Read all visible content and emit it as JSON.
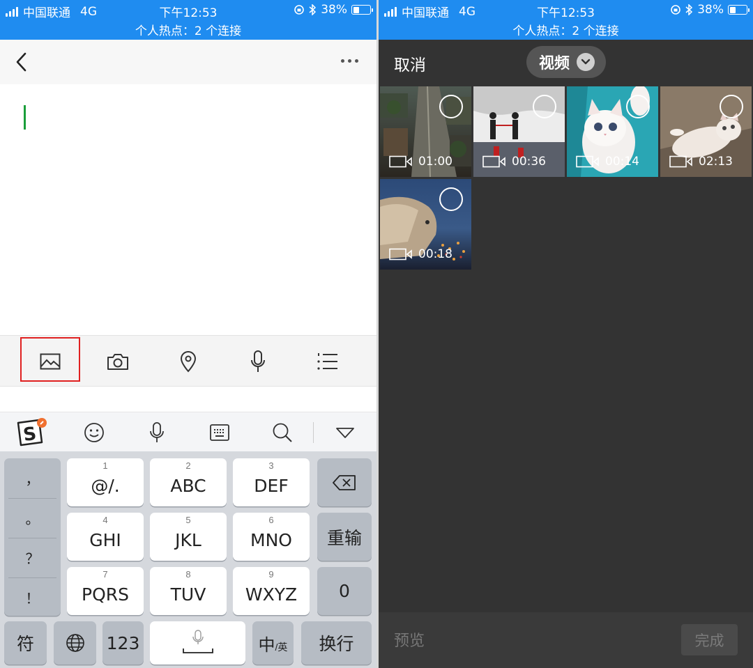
{
  "status_bar": {
    "carrier": "中国联通",
    "network": "4G",
    "time": "下午12:53",
    "battery_percent": "38%",
    "battery_level": 0.38,
    "hotspot": "个人热点：2 个连接"
  },
  "editor": {
    "text": ""
  },
  "attach_bar": {
    "items": [
      "image-icon",
      "camera-icon",
      "location-pin-icon",
      "microphone-icon",
      "list-icon"
    ],
    "highlighted": "image-icon"
  },
  "ime_toolbar": {
    "icons": [
      "sogou-logo-icon",
      "emoji-icon",
      "voice-input-icon",
      "keyboard-icon",
      "search-icon",
      "collapse-keyboard-icon"
    ]
  },
  "keyboard": {
    "punctuation": [
      "，",
      "。",
      "？",
      "！"
    ],
    "keys": [
      {
        "num": "1",
        "label": "@/."
      },
      {
        "num": "2",
        "label": "ABC"
      },
      {
        "num": "3",
        "label": "DEF"
      },
      {
        "num": "4",
        "label": "GHI"
      },
      {
        "num": "5",
        "label": "JKL"
      },
      {
        "num": "6",
        "label": "MNO"
      },
      {
        "num": "7",
        "label": "PQRS"
      },
      {
        "num": "8",
        "label": "TUV"
      },
      {
        "num": "9",
        "label": "WXYZ"
      }
    ],
    "retype": "重输",
    "zero": "0",
    "symbols": "符",
    "numbers": "123",
    "lang_main": "中",
    "lang_sub": "/英",
    "newline": "换行"
  },
  "picker": {
    "cancel": "取消",
    "media_type": "视频",
    "videos": [
      {
        "duration": "01:00"
      },
      {
        "duration": "00:36"
      },
      {
        "duration": "00:14"
      },
      {
        "duration": "02:13"
      },
      {
        "duration": "00:18"
      }
    ],
    "preview": "预览",
    "done": "完成"
  },
  "colors": {
    "status_bar": "#1f8cf0",
    "caret": "#1a9e3a",
    "highlight_box": "#e02020",
    "picker_background": "#333333"
  }
}
